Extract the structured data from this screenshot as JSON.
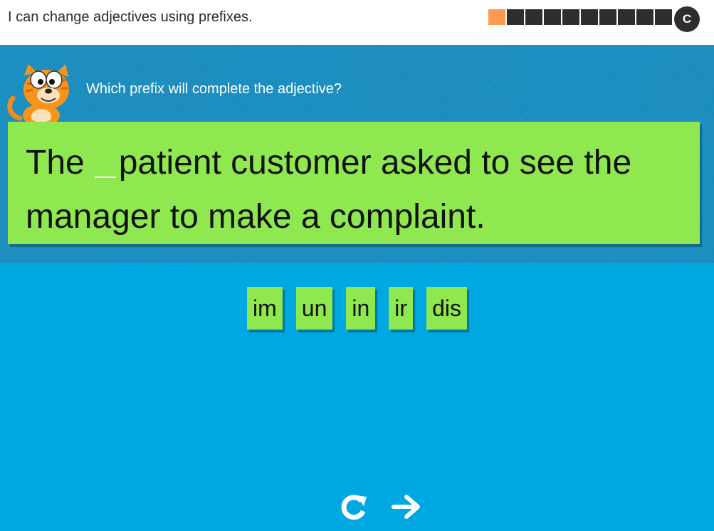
{
  "header": {
    "title": "I can change adjectives using prefixes.",
    "progress": {
      "total": 10,
      "completed": 1
    },
    "restart_button_label": "C"
  },
  "question": {
    "prompt": "Which prefix will complete the adjective?",
    "sentence_before": "The",
    "sentence_after": "patient customer asked to see the manager to make a complaint."
  },
  "options": [
    "im",
    "un",
    "in",
    "ir",
    "dis"
  ],
  "controls": {
    "retry_icon": "redo-icon",
    "next_icon": "arrow-right-icon"
  },
  "colors": {
    "card": "#8fe84f",
    "band": "#1a8fc2",
    "background": "#00a8e1",
    "progress_done": "#ff9a52",
    "progress_todo": "#2e2e2e"
  }
}
